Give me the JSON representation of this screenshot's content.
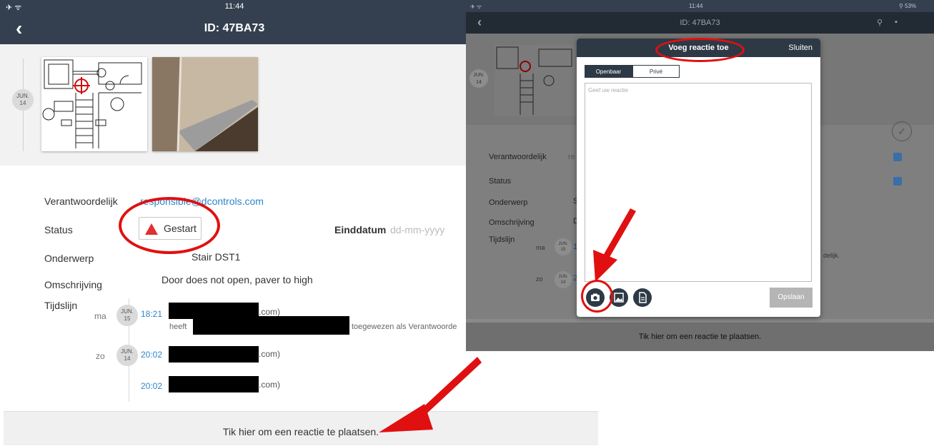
{
  "left": {
    "statusbar": {
      "signal": "✈ ᯤ",
      "time": "11:44"
    },
    "navbar": {
      "title": "ID: 47BA73"
    },
    "photos": {
      "date": [
        "JUN.",
        "14"
      ]
    },
    "fields": {
      "verantwoordelijk_label": "Verantwoordelijk",
      "verantwoordelijk_value": "responsible@dcontrols.com",
      "status_label": "Status",
      "status_value": "Gestart",
      "einddatum_label": "Einddatum",
      "einddatum_placeholder": "dd-mm-yyyy",
      "onderwerp_label": "Onderwerp",
      "onderwerp_value": "Stair DST1",
      "omschrijving_label": "Omschrijving",
      "omschrijving_value": "Door does not open, paver to high",
      "tijdslijn_label": "Tijdslijn"
    },
    "timeline": [
      {
        "day": "ma",
        "date": [
          "JUN.",
          "15"
        ],
        "time": "18:21",
        "text_tail": ".com)",
        "sub_prefix": "heeft",
        "sub_tail": "toegewezen als Verantwoorde"
      },
      {
        "day": "zo",
        "date": [
          "JUN.",
          "14"
        ],
        "time": "20:02",
        "text_tail": ".com)"
      },
      {
        "time": "20:02",
        "text_tail": ".com)"
      }
    ],
    "bottom": "Tik hier om een reactie te plaatsen."
  },
  "right": {
    "statusbar": {
      "left": "✈ ᯤ",
      "time": "11:44",
      "battery": "⚲ 53%"
    },
    "navbar": {
      "title": "ID: 47BA73"
    },
    "photos": {
      "date": [
        "JUN.",
        "14"
      ]
    },
    "labels": {
      "verantwoordelijk": "Verantwoordelijk",
      "verantwoordelijk_peek": "re",
      "status": "Status",
      "onderwerp": "Onderwerp",
      "onderwerp_peek": "S",
      "omschrijving": "Omschrijving",
      "omschrijving_peek": "D",
      "tijdslijn": "Tijdslijn"
    },
    "timeline": [
      {
        "day": "ma",
        "date": [
          "JUN.",
          "15"
        ],
        "peek": "1"
      },
      {
        "day": "zo",
        "date": [
          "JUN.",
          "14"
        ],
        "peek": "2"
      }
    ],
    "bg_tail": "delijk.",
    "bottom": "Tik hier om een reactie te plaatsen.",
    "dialog": {
      "title": "Voeg reactie toe",
      "close": "Sluiten",
      "tab_public": "Openbaar",
      "tab_private": "Privé",
      "placeholder": "Geef uw reactie",
      "save": "Opslaan"
    }
  },
  "colors": {
    "accent_red": "#e01010",
    "nav": "#34404f",
    "link": "#2e86c9"
  }
}
